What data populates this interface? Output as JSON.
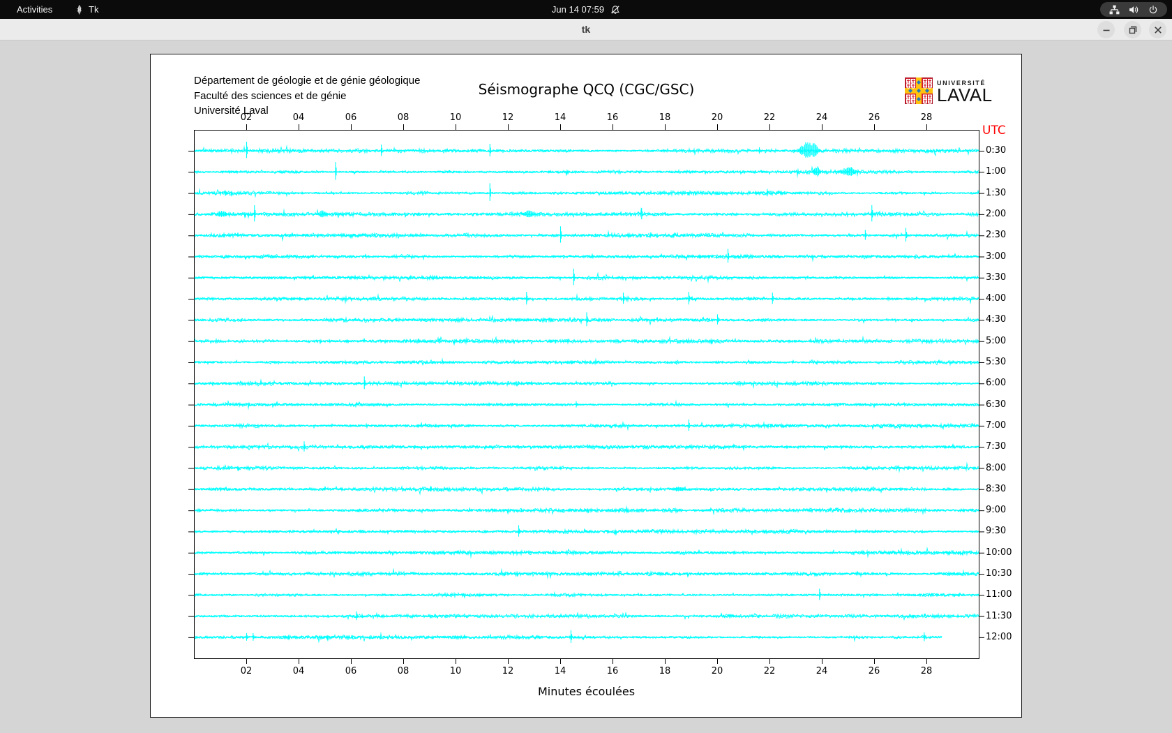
{
  "topbar": {
    "activities_label": "Activities",
    "app_name": "Tk",
    "clock": "Jun 14  07:59"
  },
  "titlebar": {
    "title": "tk"
  },
  "header": {
    "line1": "Département de géologie et de génie géologique",
    "line2": "Faculté des sciences et de génie",
    "line3": "Université Laval"
  },
  "logo": {
    "word1": "UNIVERSITÉ",
    "word2": "LAVAL"
  },
  "chart_data": {
    "type": "line",
    "title": "Séismographe QCQ (CGC/GSC)",
    "xlabel": "Minutes écoulées",
    "right_axis_title": "UTC",
    "x_range_minutes": [
      0,
      30
    ],
    "x_tick_minutes": [
      2,
      4,
      6,
      8,
      10,
      12,
      14,
      16,
      18,
      20,
      22,
      24,
      26,
      28
    ],
    "x_tick_labels": [
      "02",
      "04",
      "06",
      "08",
      "10",
      "12",
      "14",
      "16",
      "18",
      "20",
      "22",
      "24",
      "26",
      "28"
    ],
    "grid": false,
    "legend": "none",
    "trace_color": "#00ffff",
    "axis_color": "#000000",
    "utc_color": "#ff0000",
    "trace_description": "24 half-hour seismogram sweeps, noise band with transient spikes; spike entries are [minute, amplitude_px, optional_width_min]",
    "traces": [
      {
        "time": "0:30",
        "end": 30,
        "spikes": [
          [
            2.0,
            13
          ],
          [
            7.15,
            9
          ],
          [
            11.3,
            10
          ],
          [
            21.6,
            5
          ],
          [
            23.5,
            15,
            0.9
          ]
        ]
      },
      {
        "time": "1:00",
        "end": 30,
        "spikes": [
          [
            5.4,
            14
          ],
          [
            23.8,
            9,
            0.35
          ],
          [
            25.0,
            8,
            0.8
          ]
        ]
      },
      {
        "time": "1:30",
        "end": 30,
        "spikes": [
          [
            11.3,
            14
          ],
          [
            21.9,
            6
          ]
        ]
      },
      {
        "time": "2:00",
        "end": 30,
        "spikes": [
          [
            1.05,
            6,
            0.5
          ],
          [
            2.3,
            13
          ],
          [
            4.9,
            6,
            0.45
          ],
          [
            12.8,
            7,
            0.5
          ],
          [
            17.1,
            9
          ],
          [
            25.9,
            13
          ]
        ]
      },
      {
        "time": "2:30",
        "end": 30,
        "spikes": [
          [
            14.0,
            13
          ],
          [
            25.65,
            8
          ],
          [
            27.2,
            11
          ]
        ]
      },
      {
        "time": "3:00",
        "end": 30,
        "spikes": [
          [
            20.4,
            11
          ]
        ]
      },
      {
        "time": "3:30",
        "end": 30,
        "spikes": [
          [
            14.5,
            13
          ]
        ]
      },
      {
        "time": "4:00",
        "end": 30,
        "spikes": [
          [
            12.7,
            10
          ],
          [
            16.4,
            9
          ],
          [
            18.9,
            10
          ],
          [
            22.1,
            9
          ]
        ]
      },
      {
        "time": "4:30",
        "end": 30,
        "spikes": [
          [
            15.0,
            11
          ],
          [
            20.0,
            8
          ]
        ]
      },
      {
        "time": "5:00",
        "end": 30,
        "spikes": []
      },
      {
        "time": "5:30",
        "end": 30,
        "spikes": []
      },
      {
        "time": "6:00",
        "end": 30,
        "spikes": [
          [
            6.5,
            10
          ]
        ]
      },
      {
        "time": "6:30",
        "end": 30,
        "spikes": [
          [
            14.6,
            5
          ]
        ]
      },
      {
        "time": "7:00",
        "end": 30,
        "spikes": [
          [
            18.9,
            9
          ]
        ]
      },
      {
        "time": "7:30",
        "end": 30,
        "spikes": [
          [
            4.2,
            8
          ]
        ]
      },
      {
        "time": "8:00",
        "end": 30,
        "spikes": []
      },
      {
        "time": "8:30",
        "end": 30,
        "spikes": [
          [
            18.5,
            4,
            0.7
          ]
        ]
      },
      {
        "time": "9:00",
        "end": 30,
        "spikes": []
      },
      {
        "time": "9:30",
        "end": 30,
        "spikes": [
          [
            12.4,
            9
          ]
        ]
      },
      {
        "time": "10:00",
        "end": 30,
        "spikes": []
      },
      {
        "time": "10:30",
        "end": 30,
        "spikes": []
      },
      {
        "time": "11:00",
        "end": 30,
        "spikes": [
          [
            23.9,
            9
          ]
        ]
      },
      {
        "time": "11:30",
        "end": 30,
        "spikes": [
          [
            6.2,
            7
          ]
        ]
      },
      {
        "time": "12:00",
        "end": 28.6,
        "spikes": [
          [
            2.0,
            6
          ],
          [
            2.25,
            6
          ],
          [
            14.4,
            10
          ],
          [
            27.9,
            7
          ]
        ]
      }
    ]
  }
}
